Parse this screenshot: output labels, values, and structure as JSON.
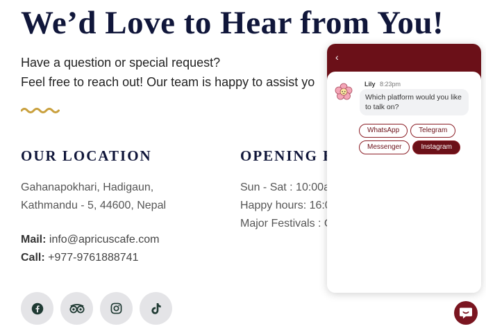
{
  "page": {
    "title": "We’d Love to Hear from You!",
    "intro_line1": "Have a question or special request?",
    "intro_line2": "Feel free to reach out! Our team is happy to assist yo"
  },
  "location": {
    "heading": "OUR LOCATION",
    "address_line1": "Gahanapokhari, Hadigaun,",
    "address_line2": "Kathmandu - 5, 44600, Nepal",
    "mail_label": "Mail:",
    "mail_value": "info@apricuscafe.com",
    "call_label": "Call:",
    "call_value": "+977-9761888741"
  },
  "hours": {
    "heading": "OPENING H",
    "line1": "Sun - Sat : 10:00a",
    "line2": "Happy hours: 16:0",
    "line3": "Major Festivals : C"
  },
  "socials": {
    "icons": [
      "facebook-icon",
      "tripadvisor-icon",
      "instagram-icon",
      "tiktok-icon"
    ]
  },
  "chat": {
    "back_icon": "‹",
    "agent_name": "Lily",
    "time": "8:23pm",
    "message": "Which platform would you like to talk on?",
    "options": [
      "WhatsApp",
      "Telegram",
      "Messenger",
      "Instagram"
    ],
    "selected_option": "Instagram"
  },
  "colors": {
    "title": "#10163a",
    "accent_gold": "#c9a03d",
    "chat_brand": "#6b1018",
    "social_icon": "#1f3a33"
  }
}
